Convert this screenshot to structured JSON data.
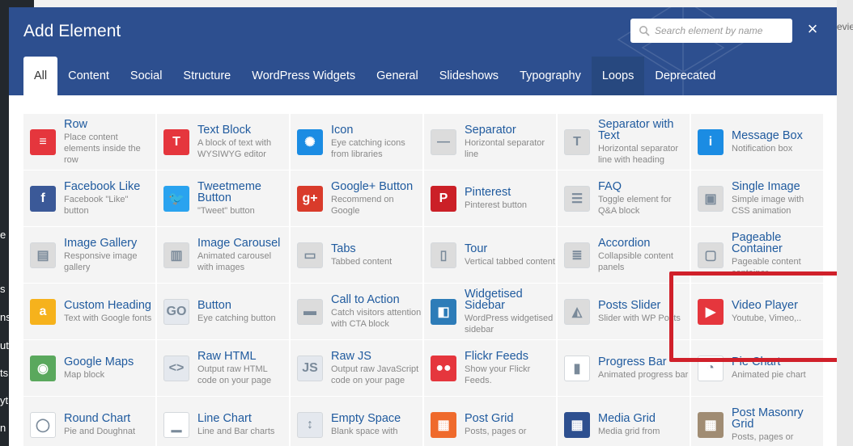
{
  "background": {
    "left_letters": [
      "e",
      "s",
      "ns",
      "ut",
      "ts",
      "yt",
      "n"
    ],
    "right_text": "evie"
  },
  "modal": {
    "title": "Add Element",
    "search_placeholder": "Search element by name",
    "close_label": "×"
  },
  "tabs": [
    {
      "label": "All",
      "active": true
    },
    {
      "label": "Content"
    },
    {
      "label": "Social"
    },
    {
      "label": "Structure"
    },
    {
      "label": "WordPress Widgets"
    },
    {
      "label": "General"
    },
    {
      "label": "Slideshows"
    },
    {
      "label": "Typography"
    },
    {
      "label": "Loops"
    },
    {
      "label": "Deprecated"
    }
  ],
  "elements": [
    {
      "name": "Row",
      "desc": "Place content elements inside the row",
      "icon": "row-icon",
      "color": "#e5363d",
      "glyph": "≡"
    },
    {
      "name": "Text Block",
      "desc": "A block of text with WYSIWYG editor",
      "icon": "text-block-icon",
      "color": "#e5363d",
      "glyph": "T"
    },
    {
      "name": "Icon",
      "desc": "Eye catching icons from libraries",
      "icon": "icon-element-icon",
      "color": "#1b8ce3",
      "glyph": "✺"
    },
    {
      "name": "Separator",
      "desc": "Horizontal separator line",
      "icon": "separator-icon",
      "color": "#dcdcdc",
      "glyph": "—"
    },
    {
      "name": "Separator with Text",
      "desc": "Horizontal separator line with heading",
      "icon": "separator-text-icon",
      "color": "#dcdcdc",
      "glyph": "T"
    },
    {
      "name": "Message Box",
      "desc": "Notification box",
      "icon": "message-box-icon",
      "color": "#1b8ce3",
      "glyph": "i"
    },
    {
      "name": "Facebook Like",
      "desc": "Facebook \"Like\" button",
      "icon": "facebook-icon",
      "color": "#3b5998",
      "glyph": "f"
    },
    {
      "name": "Tweetmeme Button",
      "desc": "\"Tweet\" button",
      "icon": "twitter-icon",
      "color": "#2aa3ef",
      "glyph": "🐦"
    },
    {
      "name": "Google+ Button",
      "desc": "Recommend on Google",
      "icon": "google-plus-icon",
      "color": "#d93b2b",
      "glyph": "g+"
    },
    {
      "name": "Pinterest",
      "desc": "Pinterest button",
      "icon": "pinterest-icon",
      "color": "#cb2027",
      "glyph": "P"
    },
    {
      "name": "FAQ",
      "desc": "Toggle element for Q&A block",
      "icon": "faq-icon",
      "color": "#dcdcdc",
      "glyph": "☰"
    },
    {
      "name": "Single Image",
      "desc": "Simple image with CSS animation",
      "icon": "single-image-icon",
      "color": "#dcdcdc",
      "glyph": "▣"
    },
    {
      "name": "Image Gallery",
      "desc": "Responsive image gallery",
      "icon": "image-gallery-icon",
      "color": "#dcdcdc",
      "glyph": "▤"
    },
    {
      "name": "Image Carousel",
      "desc": "Animated carousel with images",
      "icon": "image-carousel-icon",
      "color": "#dcdcdc",
      "glyph": "▥"
    },
    {
      "name": "Tabs",
      "desc": "Tabbed content",
      "icon": "tabs-icon",
      "color": "#dcdcdc",
      "glyph": "▭"
    },
    {
      "name": "Tour",
      "desc": "Vertical tabbed content",
      "icon": "tour-icon",
      "color": "#dcdcdc",
      "glyph": "▯"
    },
    {
      "name": "Accordion",
      "desc": "Collapsible content panels",
      "icon": "accordion-icon",
      "color": "#dcdcdc",
      "glyph": "≣"
    },
    {
      "name": "Pageable Container",
      "desc": "Pageable content container",
      "icon": "pageable-container-icon",
      "color": "#dcdcdc",
      "glyph": "▢"
    },
    {
      "name": "Custom Heading",
      "desc": "Text with Google fonts",
      "icon": "custom-heading-icon",
      "color": "#f6b21c",
      "glyph": "a"
    },
    {
      "name": "Button",
      "desc": "Eye catching button",
      "icon": "button-icon",
      "color": "#e4e8ee",
      "glyph": "GO"
    },
    {
      "name": "Call to Action",
      "desc": "Catch visitors attention with CTA block",
      "icon": "call-to-action-icon",
      "color": "#dcdcdc",
      "glyph": "▬"
    },
    {
      "name": "Widgetised Sidebar",
      "desc": "WordPress widgetised sidebar",
      "icon": "widgetised-sidebar-icon",
      "color": "#2d7cb8",
      "glyph": "◧"
    },
    {
      "name": "Posts Slider",
      "desc": "Slider with WP Posts",
      "icon": "posts-slider-icon",
      "color": "#dcdcdc",
      "glyph": "◭"
    },
    {
      "name": "Video Player",
      "desc": "Youtube, Vimeo,..",
      "icon": "video-player-icon",
      "color": "#e5363d",
      "glyph": "▶"
    },
    {
      "name": "Google Maps",
      "desc": "Map block",
      "icon": "google-maps-icon",
      "color": "#5aa85d",
      "glyph": "◉"
    },
    {
      "name": "Raw HTML",
      "desc": "Output raw HTML code on your page",
      "icon": "raw-html-icon",
      "color": "#e4e8ee",
      "glyph": "<>"
    },
    {
      "name": "Raw JS",
      "desc": "Output raw JavaScript code on your page",
      "icon": "raw-js-icon",
      "color": "#e4e8ee",
      "glyph": "JS"
    },
    {
      "name": "Flickr Feeds",
      "desc": "Show your Flickr Feeds.",
      "icon": "flickr-icon",
      "color": "#e5363d",
      "glyph": "●●"
    },
    {
      "name": "Progress Bar",
      "desc": "Animated progress bar",
      "icon": "progress-bar-icon",
      "color": "#ffffff",
      "glyph": "▮"
    },
    {
      "name": "Pie Chart",
      "desc": "Animated pie chart",
      "icon": "pie-chart-icon",
      "color": "#ffffff",
      "glyph": "◔"
    },
    {
      "name": "Round Chart",
      "desc": "Pie and Doughnat",
      "icon": "round-chart-icon",
      "color": "#ffffff",
      "glyph": "◯"
    },
    {
      "name": "Line Chart",
      "desc": "Line and Bar charts",
      "icon": "line-chart-icon",
      "color": "#ffffff",
      "glyph": "▁"
    },
    {
      "name": "Empty Space",
      "desc": "Blank space with",
      "icon": "empty-space-icon",
      "color": "#e4e8ee",
      "glyph": "↕"
    },
    {
      "name": "Post Grid",
      "desc": "Posts, pages or",
      "icon": "post-grid-icon",
      "color": "#ef6a2c",
      "glyph": "▦"
    },
    {
      "name": "Media Grid",
      "desc": "Media grid from",
      "icon": "media-grid-icon",
      "color": "#2d4f8f",
      "glyph": "▦"
    },
    {
      "name": "Post Masonry Grid",
      "desc": "Posts, pages or",
      "icon": "post-masonry-grid-icon",
      "color": "#a08c73",
      "glyph": "▦"
    }
  ]
}
